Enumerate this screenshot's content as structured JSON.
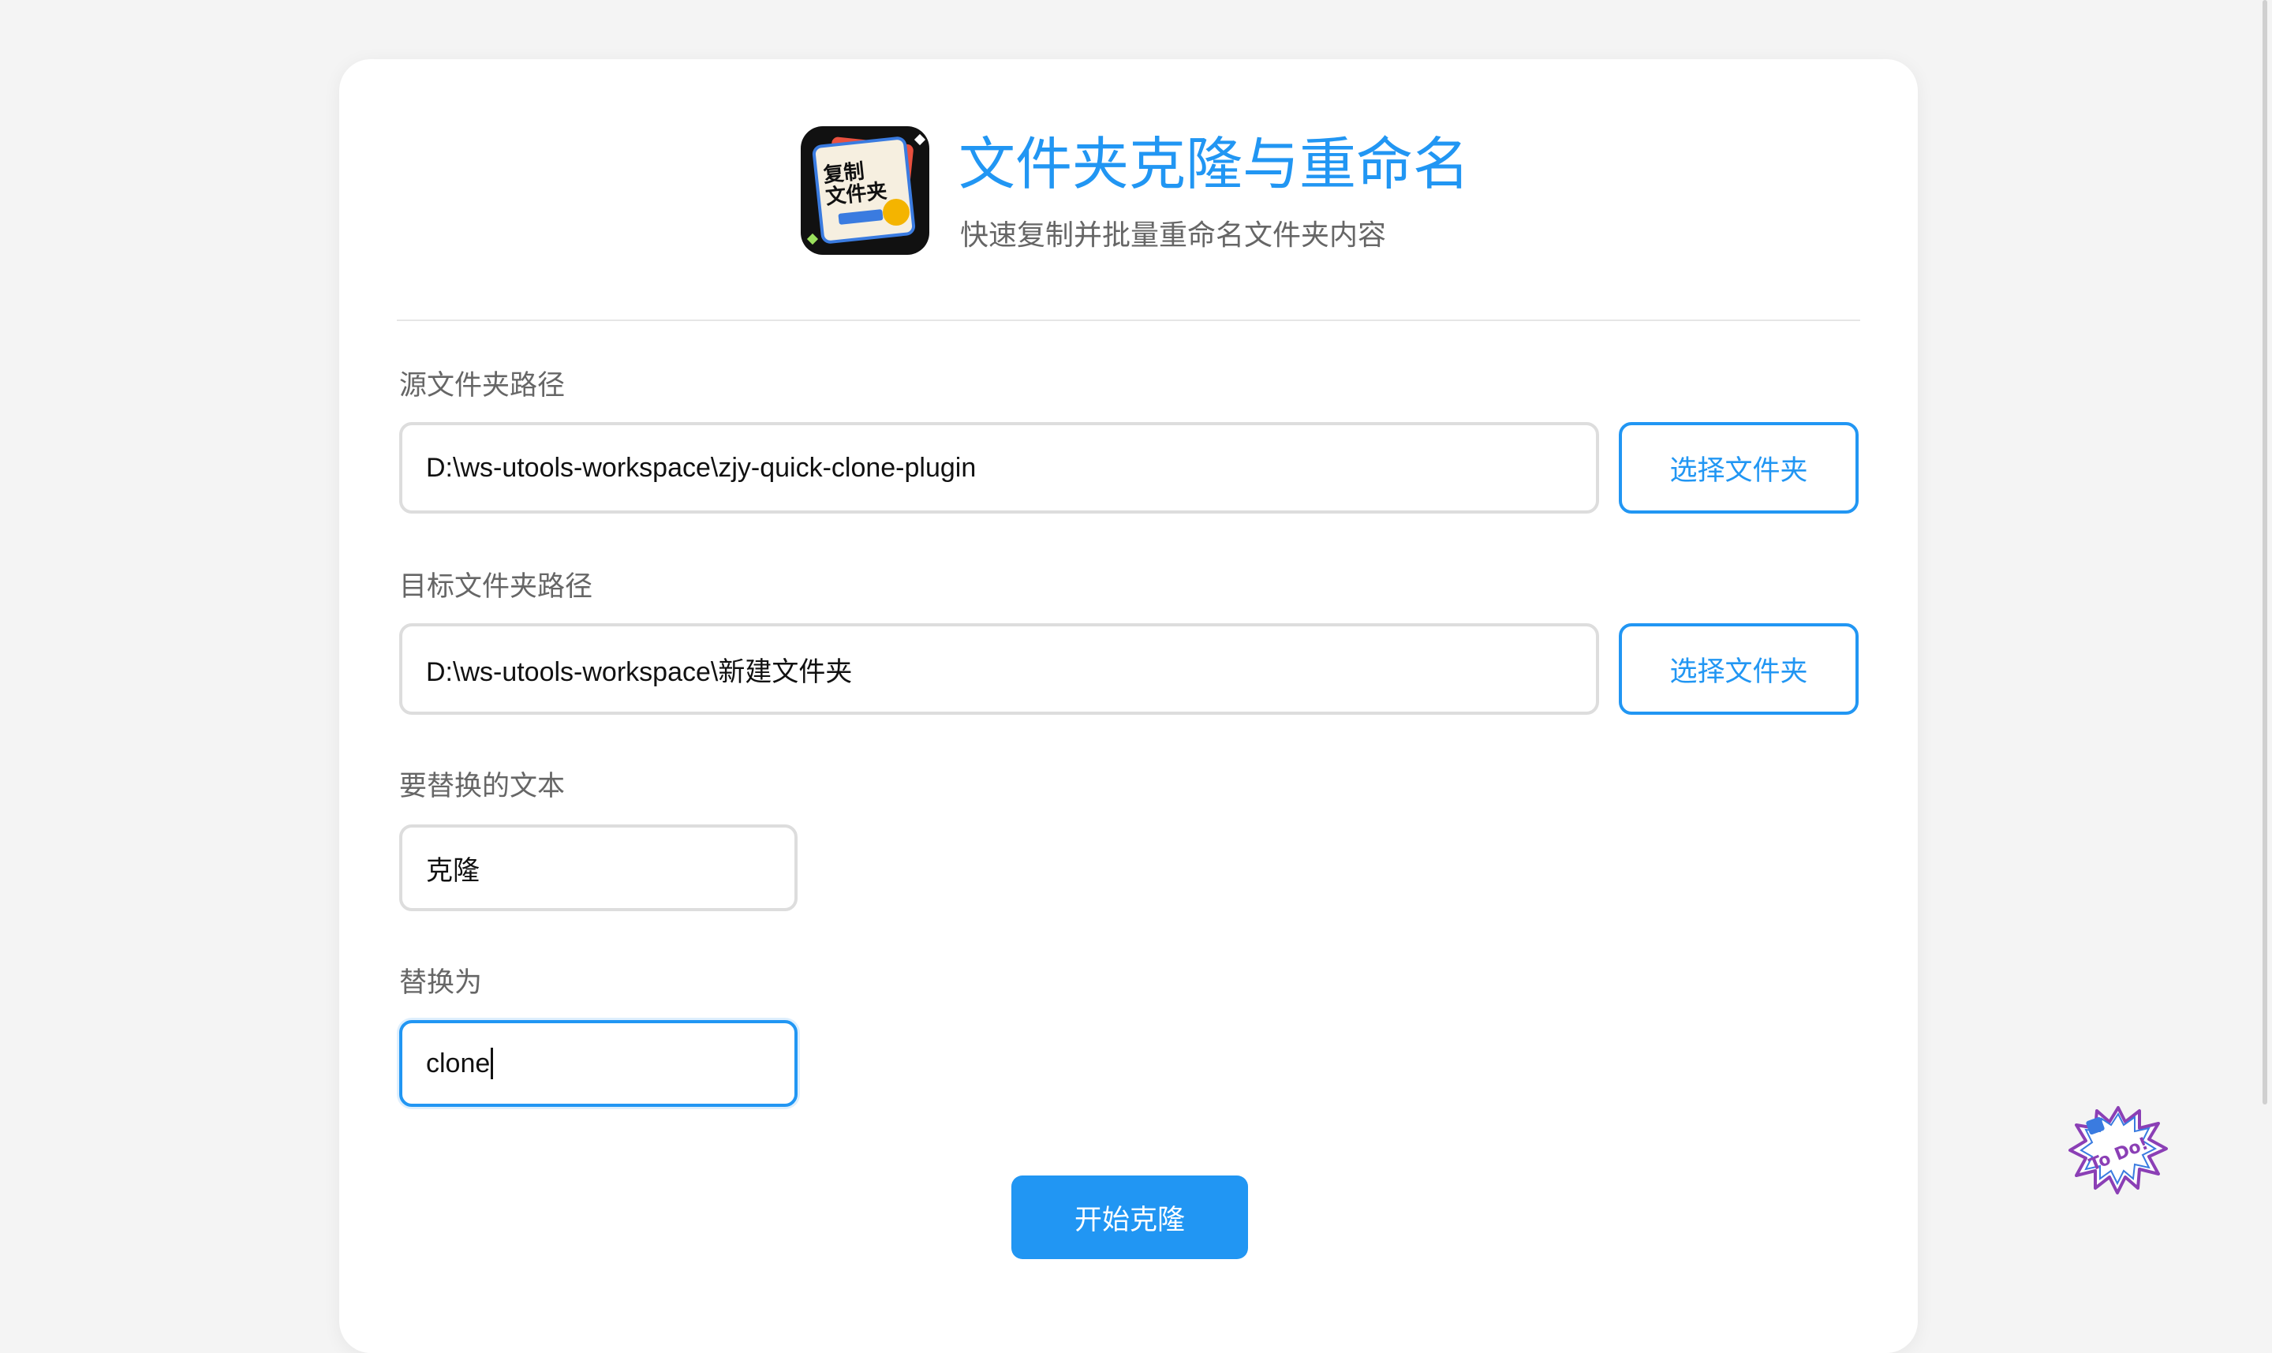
{
  "header": {
    "title": "文件夹克隆与重命名",
    "subtitle": "快速复制并批量重命名文件夹内容",
    "logo_text": "复制\n文件夹",
    "logo_icon": "app-logo-icon"
  },
  "form": {
    "source": {
      "label": "源文件夹路径",
      "value": "D:\\ws-utools-workspace\\zjy-quick-clone-plugin",
      "button": "选择文件夹"
    },
    "target": {
      "label": "目标文件夹路径",
      "value": "D:\\ws-utools-workspace\\新建文件夹",
      "button": "选择文件夹"
    },
    "replace_from": {
      "label": "要替换的文本",
      "value": "克隆"
    },
    "replace_to": {
      "label": "替换为",
      "value": "clone"
    },
    "submit": "开始克隆"
  },
  "floating": {
    "todo_text": "To Do!",
    "icon": "todo-badge-icon"
  },
  "colors": {
    "accent": "#2196f3",
    "background": "#f4f4f4",
    "card": "#ffffff",
    "label": "#666666",
    "border": "#dddddd"
  }
}
